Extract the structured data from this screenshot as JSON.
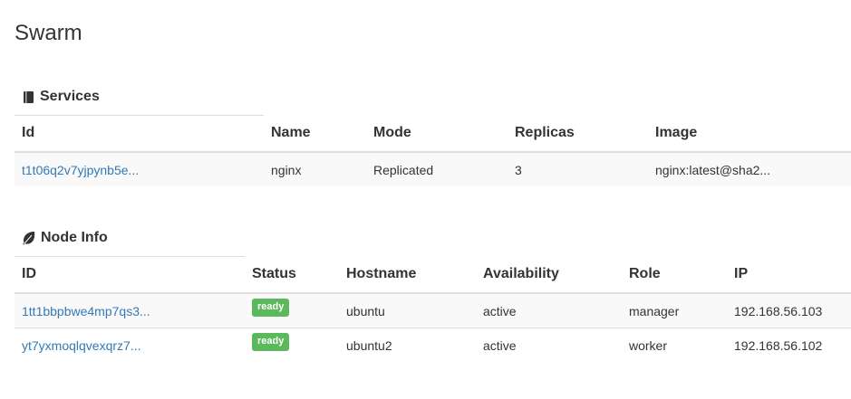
{
  "page": {
    "title": "Swarm"
  },
  "services": {
    "title": "Services",
    "icon": "book-icon",
    "columns": [
      "Id",
      "Name",
      "Mode",
      "Replicas",
      "Image"
    ],
    "rows": [
      {
        "id": "t1t06q2v7yjpynb5e...",
        "name": "nginx",
        "mode": "Replicated",
        "replicas": "3",
        "image": "nginx:latest@sha2..."
      }
    ]
  },
  "nodes": {
    "title": "Node Info",
    "icon": "leaf-icon",
    "columns": [
      "ID",
      "Status",
      "Hostname",
      "Availability",
      "Role",
      "IP"
    ],
    "rows": [
      {
        "id": "1tt1bbpbwe4mp7qs3...",
        "status": "ready",
        "hostname": "ubuntu",
        "availability": "active",
        "role": "manager",
        "ip": "192.168.56.103"
      },
      {
        "id": "yt7yxmoqlqvexqrz7...",
        "status": "ready",
        "hostname": "ubuntu2",
        "availability": "active",
        "role": "worker",
        "ip": "192.168.56.102"
      }
    ]
  },
  "colors": {
    "link": "#337ab7",
    "badge_success": "#5cb85c",
    "border": "#dddddd",
    "stripe": "#f9f9f9"
  }
}
